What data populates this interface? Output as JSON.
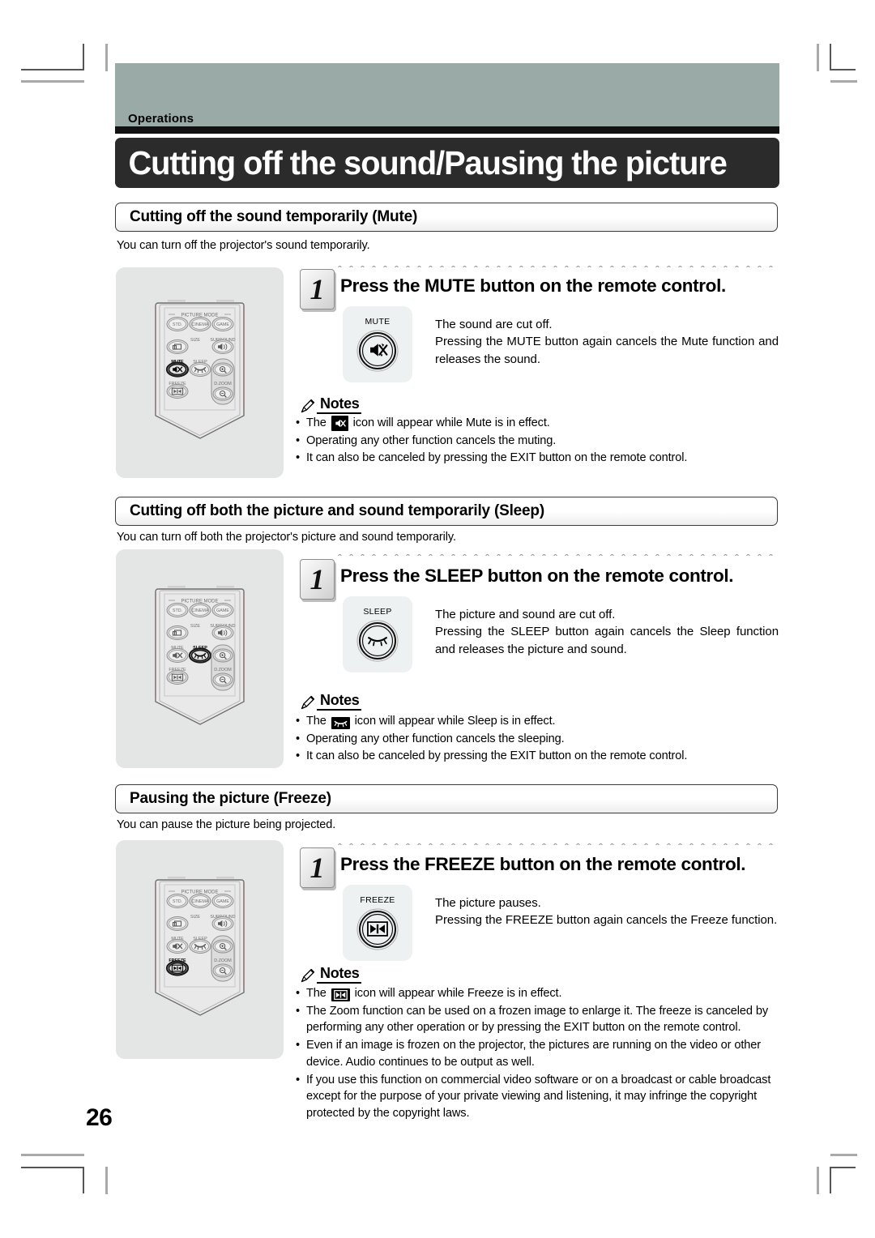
{
  "page": {
    "chapter_label": "Operations",
    "title": "Cutting off the sound/Pausing the picture",
    "page_number": "26",
    "accent_band_color": "#9aaaa6",
    "title_bar_color": "#2b2b2b"
  },
  "remote": {
    "group_label": "PICTURE MODE",
    "buttons": {
      "std": "STD.",
      "cinema": "CINEMA",
      "game": "GAME",
      "size": "SIZE",
      "surround": "SURROUND",
      "mute": "MUTE",
      "sleep": "SLEEP",
      "freeze": "FREEZE",
      "dzoom": "D.ZOOM"
    }
  },
  "notes_label": "Notes",
  "sections": [
    {
      "heading": "Cutting off the sound temporarily (Mute)",
      "intro": "You can turn off the projector's sound temporarily.",
      "step_number": "1",
      "step_title": "Press the MUTE button on the remote control.",
      "key_label": "MUTE",
      "key_icon": "mute-icon",
      "highlight": "mute",
      "body": [
        "The sound are cut off.",
        "Pressing the MUTE button again cancels the Mute function and releases the sound."
      ],
      "notes": [
        {
          "pre": "The ",
          "icon": "mute-icon",
          "post": " icon will appear while Mute is in effect."
        },
        {
          "pre": "Operating any other function cancels the muting.",
          "icon": "",
          "post": ""
        },
        {
          "pre": "It can also be canceled by pressing the EXIT button on the remote control.",
          "icon": "",
          "post": ""
        }
      ]
    },
    {
      "heading": "Cutting off both the picture and sound temporarily (Sleep)",
      "intro": "You can turn off both the projector's picture and sound temporarily.",
      "step_number": "1",
      "step_title": "Press the SLEEP button on the remote control.",
      "key_label": "SLEEP",
      "key_icon": "sleep-icon",
      "highlight": "sleep",
      "body": [
        "The picture and sound are cut off.",
        "Pressing the SLEEP button again cancels the Sleep function and releases the picture and sound."
      ],
      "notes": [
        {
          "pre": "The ",
          "icon": "sleep-icon",
          "post": " icon will appear while Sleep is in effect."
        },
        {
          "pre": "Operating any other function cancels the sleeping.",
          "icon": "",
          "post": ""
        },
        {
          "pre": "It can also be canceled by pressing the EXIT button on the remote control.",
          "icon": "",
          "post": ""
        }
      ]
    },
    {
      "heading": "Pausing the picture (Freeze)",
      "intro": "You can pause the picture being projected.",
      "step_number": "1",
      "step_title": "Press the FREEZE button on the remote control.",
      "key_label": "FREEZE",
      "key_icon": "freeze-icon",
      "highlight": "freeze",
      "body": [
        "The picture pauses.",
        "Pressing the FREEZE button again cancels the Freeze function."
      ],
      "notes": [
        {
          "pre": "The ",
          "icon": "freeze-icon",
          "post": " icon will appear while Freeze is in effect."
        },
        {
          "pre": "The Zoom function can be used on a frozen image to enlarge it. The freeze is canceled by performing any other operation or by pressing the EXIT button on the remote control.",
          "icon": "",
          "post": ""
        },
        {
          "pre": "Even if an image is frozen on the projector, the pictures are running on the video or other device. Audio continues to be output as well.",
          "icon": "",
          "post": ""
        },
        {
          "pre": "If you use this function on commercial video software or on a broadcast or cable broadcast except for the purpose of your private viewing and listening, it may infringe the copyright protected by the copyright laws.",
          "icon": "",
          "post": ""
        }
      ]
    }
  ]
}
